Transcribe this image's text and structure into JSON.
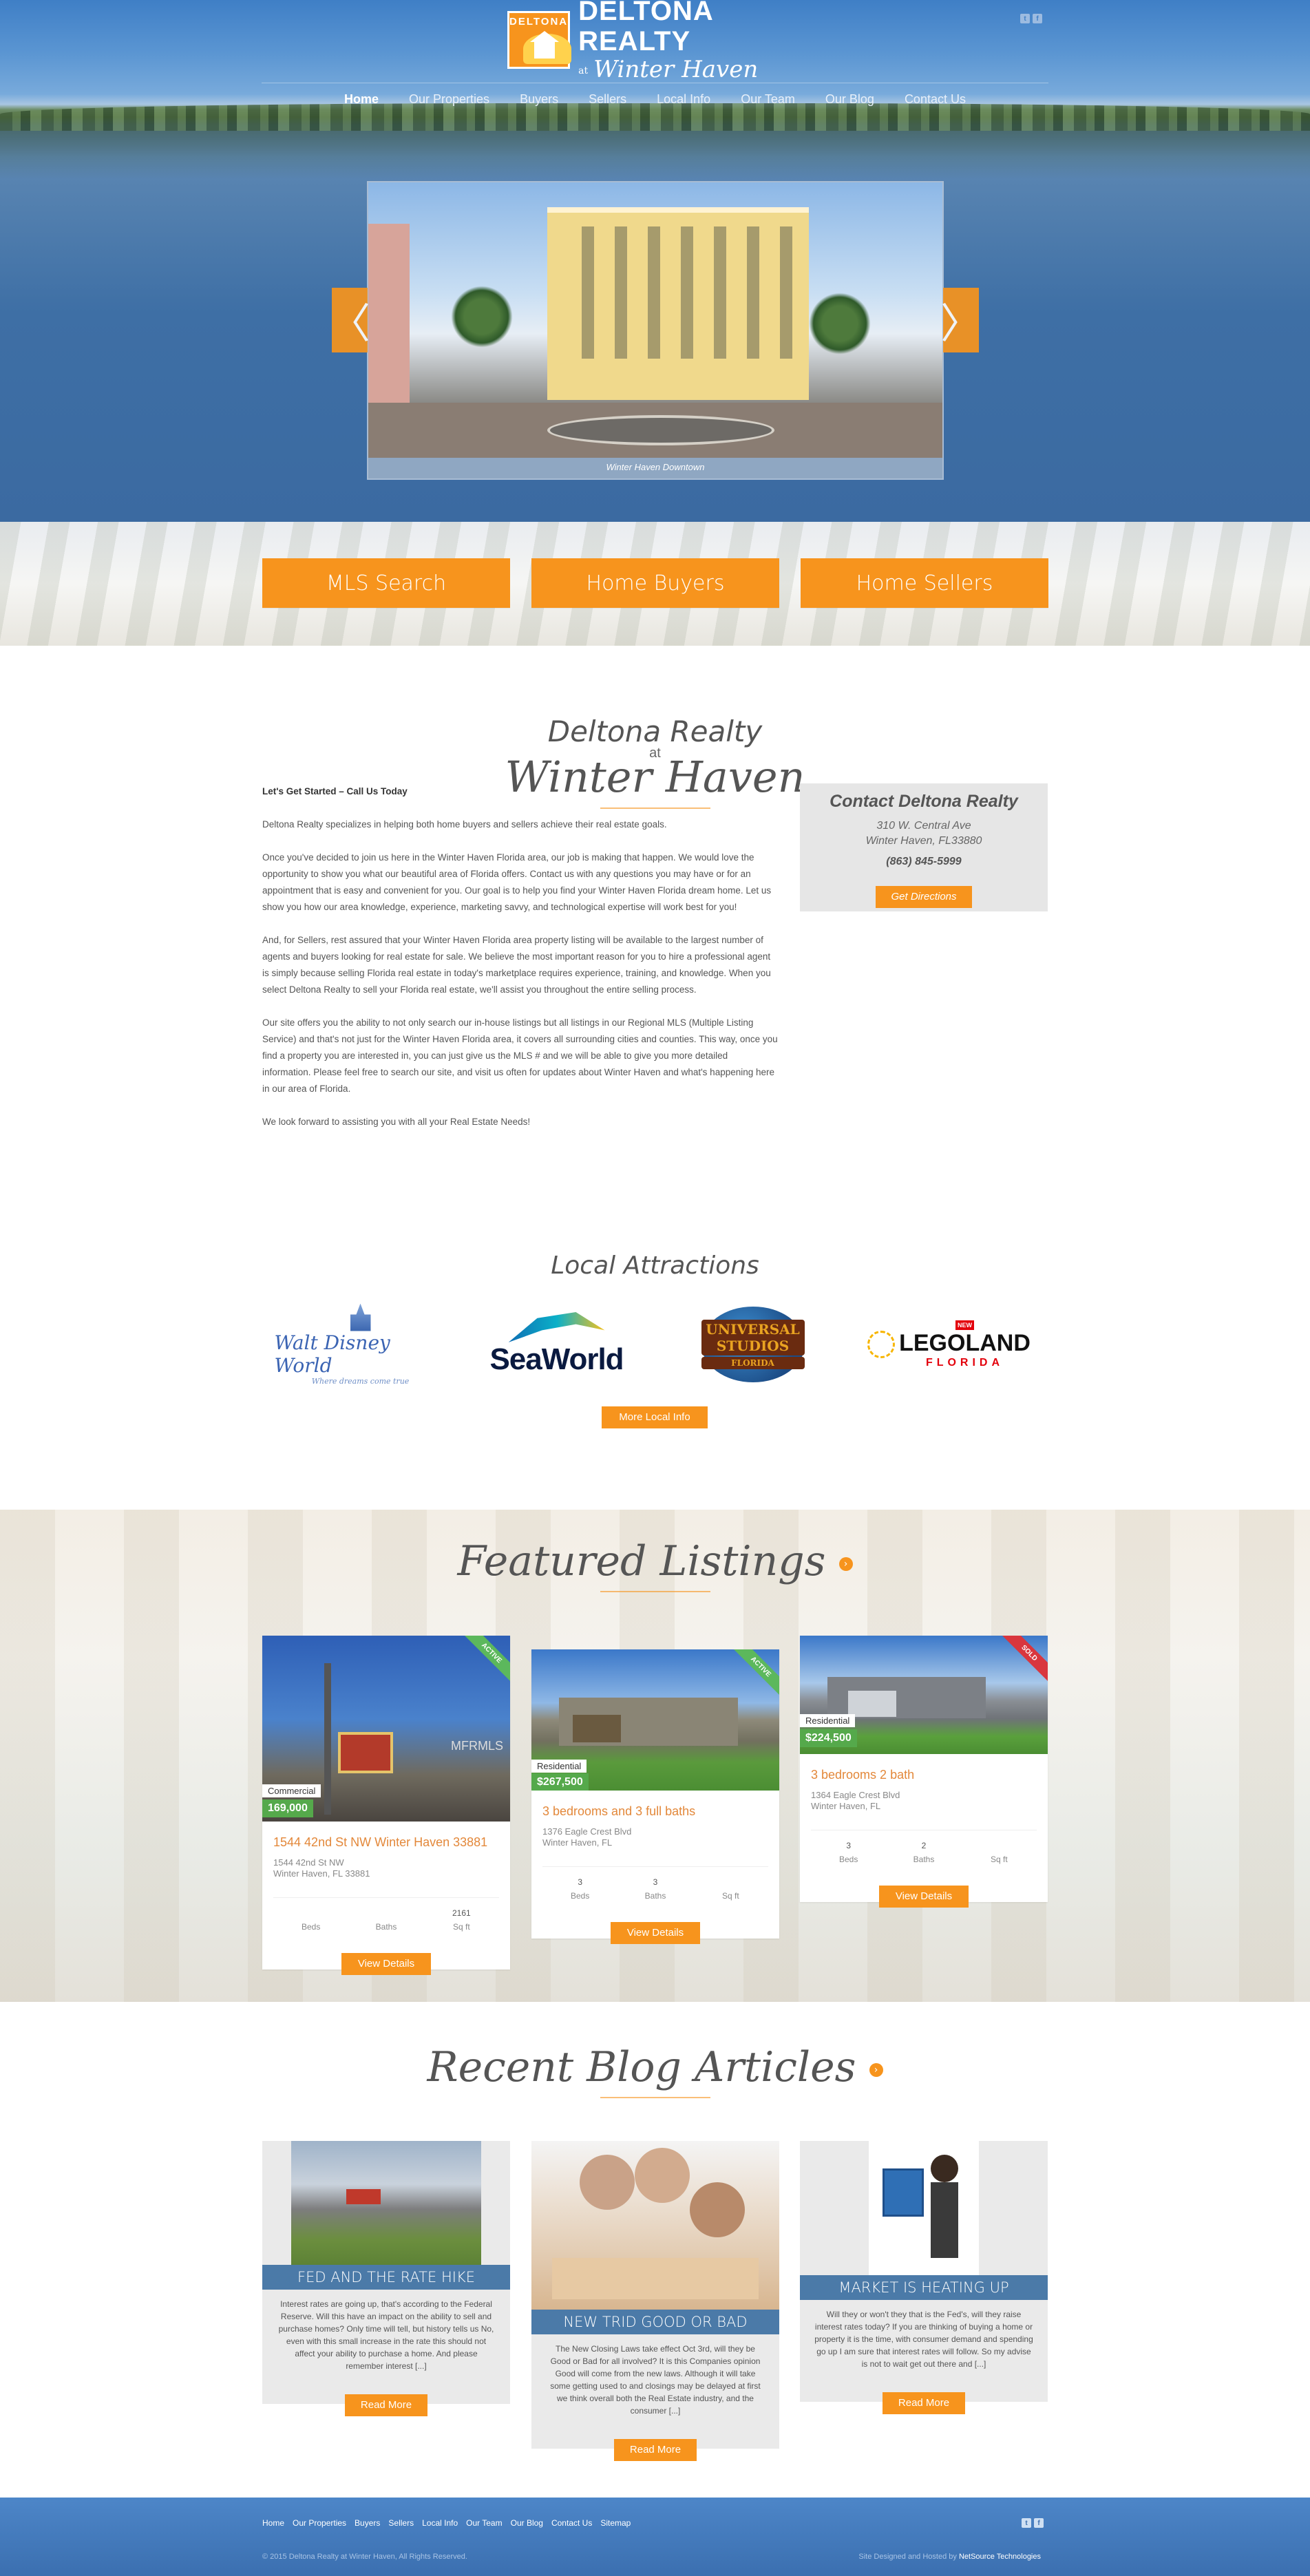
{
  "brand": {
    "badge_word": "DELTONA",
    "name_line1": "DELTONA REALTY",
    "name_at": "at",
    "name_line2": "Winter Haven"
  },
  "social_icons": [
    "twitter-icon",
    "facebook-icon"
  ],
  "nav": {
    "items": [
      "Home",
      "Our Properties",
      "Buyers",
      "Sellers",
      "Local Info",
      "Our Team",
      "Our Blog",
      "Contact Us"
    ],
    "active": "Home"
  },
  "slider": {
    "caption": "Winter Haven Downtown",
    "prev_glyph": "〈",
    "next_glyph": "〉"
  },
  "cta": [
    "MLS Search",
    "Home Buyers",
    "Home Sellers"
  ],
  "about": {
    "title_line1": "Deltona Realty",
    "title_at": "at",
    "title_line2": "Winter Haven",
    "lead": "Let's Get Started – Call Us Today",
    "paragraphs": [
      "Deltona Realty specializes in helping both home buyers and sellers achieve their real estate goals.",
      "Once you've decided to join us here in the Winter Haven Florida area, our job is making that happen. We would love the opportunity to show you what our beautiful area of Florida offers. Contact us with any questions you may have or for an appointment that is easy and convenient for you. Our goal is to help you find your Winter Haven Florida dream home. Let us show you how our area knowledge, experience, marketing savvy, and technological expertise will work best for you!",
      "And, for Sellers, rest assured that your Winter Haven Florida area property listing will be available to the largest number of agents and buyers looking for real estate for sale. We believe the most important reason for you to hire a professional agent is simply because selling Florida real estate in today's marketplace requires experience, training, and knowledge. When you select Deltona Realty to sell your Florida real estate, we'll assist you throughout the entire selling process.",
      "Our site offers you the ability to not only search our in-house listings but all listings in our Regional MLS (Multiple Listing Service) and that's not just for the Winter Haven Florida area, it covers all surrounding cities and counties. This way, once you find a property you are interested in, you can just give us the MLS # and we will be able to give you more detailed information. Please feel free to search our site, and visit us often for updates about Winter Haven and what's happening here in our area of Florida.",
      "We look forward to assisting you with all your Real Estate Needs!"
    ]
  },
  "contact": {
    "title": "Contact Deltona Realty",
    "address1": "310 W. Central Ave",
    "address2": "Winter Haven, FL33880",
    "phone": "(863) 845-5999",
    "button": "Get Directions"
  },
  "attractions": {
    "title": "Local Attractions",
    "disney_name": "Walt Disney World",
    "disney_tag": "Where dreams come true",
    "seaworld_name": "SeaWorld",
    "universal_name": "UNIVERSAL STUDIOS",
    "universal_sub": "FLORIDA",
    "lego_name": "LEGOLAND",
    "lego_sub": "FLORIDA",
    "lego_tag": "NEW",
    "button": "More Local Info"
  },
  "featured": {
    "title": "Featured Listings",
    "go_glyph": "›",
    "listings": [
      {
        "type": "Commercial",
        "price": "169,000",
        "status": "ACTIVE",
        "status_color": "#5cb85c",
        "title": "1544 42nd St NW Winter Haven 33881",
        "addr1": "1544 42nd St NW",
        "addr2": "Winter Haven, FL 33881",
        "beds": "",
        "baths": "",
        "sqft": "2161",
        "button": "View Details",
        "watermark": "MFRMLS"
      },
      {
        "type": "Residential",
        "price": "$267,500",
        "status": "ACTIVE",
        "status_color": "#5cb85c",
        "title": "3 bedrooms and 3 full baths",
        "addr1": "1376 Eagle Crest Blvd",
        "addr2": "Winter Haven, FL",
        "beds": "3",
        "baths": "3",
        "sqft": "",
        "button": "View Details"
      },
      {
        "type": "Residential",
        "price": "$224,500",
        "status": "SOLD",
        "status_color": "#d9363e",
        "title": "3 bedrooms 2 bath",
        "addr1": "1364 Eagle Crest Blvd",
        "addr2": "Winter Haven, FL",
        "beds": "3",
        "baths": "2",
        "sqft": "",
        "button": "View Details"
      }
    ],
    "labels": {
      "beds": "Beds",
      "baths": "Baths",
      "sqft": "Sq ft"
    }
  },
  "blog": {
    "title": "Recent Blog Articles",
    "posts": [
      {
        "title": "FED AND THE RATE HIKE",
        "excerpt": "Interest rates are going up, that's according to the Federal Reserve. Will this have an impact on the ability to sell and purchase homes? Only time will tell, but history tells us No, even with this small increase in the rate this should not affect your ability to purchase a home. And please remember interest [...]",
        "button": "Read More"
      },
      {
        "title": "NEW TRID GOOD OR BAD",
        "excerpt": "The New Closing Laws take effect Oct 3rd, will they be Good or Bad for all involved? It is this Companies opinion Good will come from the new laws. Although it will take some getting used to and closings may be delayed  at first we think overall both the Real Estate industry, and the consumer [...]",
        "button": "Read More"
      },
      {
        "title": "MARKET IS HEATING UP",
        "excerpt": "Will they or won't they that is the Fed's, will they raise interest rates today? If you are thinking of buying a home or property it is the time, with consumer demand and spending go up I am sure that interest rates will follow. So my advise is not to wait get out there and [...]",
        "button": "Read More"
      }
    ]
  },
  "footer": {
    "links": [
      "Home",
      "Our Properties",
      "Buyers",
      "Sellers",
      "Local Info",
      "Our Team",
      "Our Blog",
      "Contact Us",
      "Sitemap"
    ],
    "copyright": "© 2015 Deltona Realty at Winter Haven, All Rights Reserved.",
    "credit_prefix": "Site Designed and Hosted by",
    "credit_link": "NetSource Technologies"
  },
  "colors": {
    "accent": "#f7941d",
    "blue": "#4b7aa8",
    "price_green": "#55a94b"
  }
}
